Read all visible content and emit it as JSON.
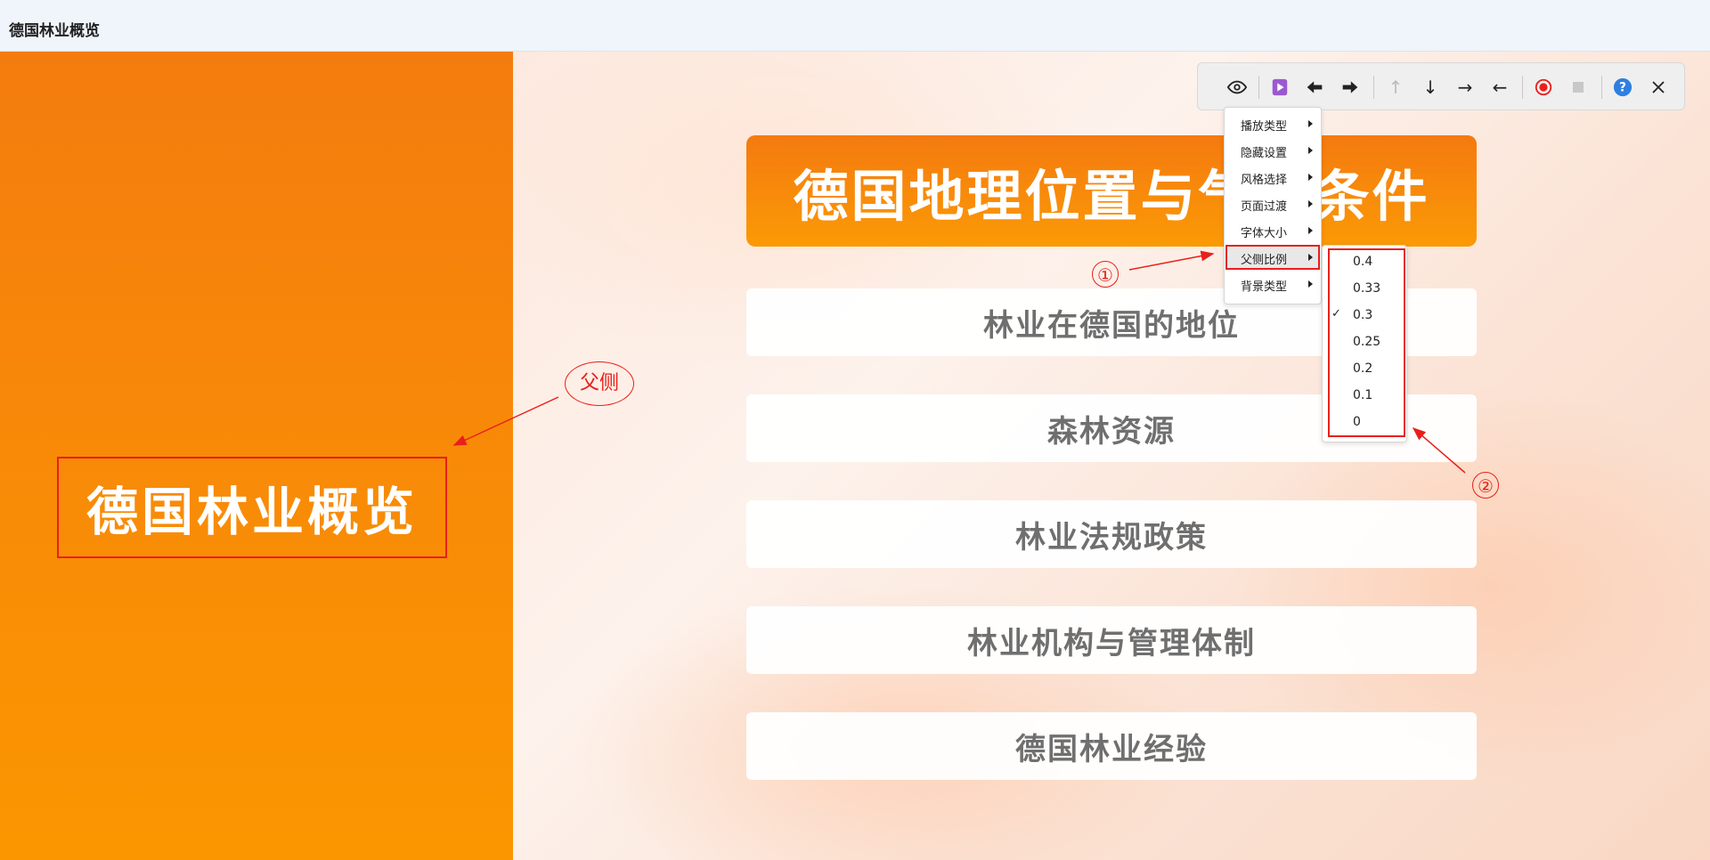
{
  "window": {
    "title": "德国林业概览"
  },
  "left_panel": {
    "title": "德国林业概览"
  },
  "slide": {
    "heading": "德国地理位置与气候条件",
    "items": [
      {
        "label": "林业在德国的地位"
      },
      {
        "label": "森林资源"
      },
      {
        "label": "林业法规政策"
      },
      {
        "label": "林业机构与管理体制"
      },
      {
        "label": "德国林业经验"
      }
    ]
  },
  "toolbar": {
    "buttons": [
      {
        "icon": "eye-icon",
        "glyph": "👁"
      },
      {
        "icon": "play-video-icon",
        "glyph": "▶"
      },
      {
        "icon": "arrow-left-bold-icon",
        "glyph": "🡄"
      },
      {
        "icon": "arrow-right-bold-icon",
        "glyph": "🡆"
      },
      {
        "icon": "arrow-up-icon",
        "glyph": "↑"
      },
      {
        "icon": "arrow-down-icon",
        "glyph": "↓"
      },
      {
        "icon": "arrow-right-icon",
        "glyph": "→"
      },
      {
        "icon": "arrow-left-icon",
        "glyph": "←"
      },
      {
        "icon": "record-icon",
        "glyph": "◉"
      },
      {
        "icon": "stop-icon",
        "glyph": "■"
      },
      {
        "icon": "help-icon",
        "glyph": "?"
      },
      {
        "icon": "close-icon",
        "glyph": "✕"
      }
    ]
  },
  "context_menu": {
    "items": [
      {
        "label": "播放类型"
      },
      {
        "label": "隐藏设置"
      },
      {
        "label": "风格选择"
      },
      {
        "label": "页面过渡"
      },
      {
        "label": "字体大小"
      },
      {
        "label": "父侧比例"
      },
      {
        "label": "背景类型"
      }
    ],
    "active_index": 5
  },
  "submenu": {
    "options": [
      {
        "label": "0.4",
        "checked": false
      },
      {
        "label": "0.33",
        "checked": false
      },
      {
        "label": "0.3",
        "checked": true
      },
      {
        "label": "0.25",
        "checked": false
      },
      {
        "label": "0.2",
        "checked": false
      },
      {
        "label": "0.1",
        "checked": false
      },
      {
        "label": "0",
        "checked": false
      }
    ],
    "check_glyph": "✓"
  },
  "annotations": {
    "marker1": "①",
    "marker2": "②",
    "parent_side_label": "父侧"
  },
  "colors": {
    "accent_orange": "#f47c0e",
    "annotation_red": "#e8201b",
    "play_icon_purple": "#9b59d0",
    "help_icon_blue": "#2f7fe0"
  }
}
